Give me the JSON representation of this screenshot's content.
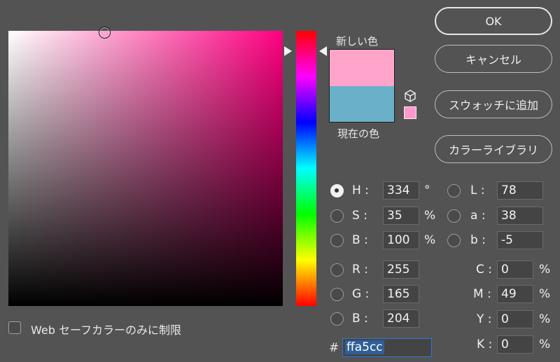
{
  "picker": {
    "new_label": "新しい色",
    "current_label": "現在の色",
    "new_color": "#ffa5cc",
    "current_color": "#6ab0c9",
    "websafe_color": "#ff99cc",
    "hue_base_color": "#ff0080"
  },
  "buttons": {
    "ok": "OK",
    "cancel": "キャンセル",
    "add_swatch": "スウォッチに追加",
    "color_library": "カラーライブラリ"
  },
  "hsb": {
    "h_label": "H :",
    "h_value": "334",
    "h_unit": "°",
    "s_label": "S :",
    "s_value": "35",
    "s_unit": "%",
    "b_label": "B :",
    "b_value": "100",
    "b_unit": "%"
  },
  "lab": {
    "l_label": "L :",
    "l_value": "78",
    "a_label": "a :",
    "a_value": "38",
    "b_label": "b :",
    "b_value": "-5"
  },
  "rgb": {
    "r_label": "R :",
    "r_value": "255",
    "g_label": "G :",
    "g_value": "165",
    "b_label": "B :",
    "b_value": "204"
  },
  "cmyk": {
    "c_label": "C :",
    "c_value": "0",
    "c_unit": "%",
    "m_label": "M :",
    "m_value": "49",
    "m_unit": "%",
    "y_label": "Y :",
    "y_value": "0",
    "y_unit": "%",
    "k_label": "K :",
    "k_value": "0",
    "k_unit": "%"
  },
  "hex": {
    "hash": "#",
    "value": "ffa5cc"
  },
  "websafe": {
    "label": "Web セーフカラーのみに制限",
    "checked": false
  },
  "selected_channel": "H",
  "icons": {
    "cube": "cube-icon",
    "hue_arrow": "triangle-arrow-icon"
  }
}
